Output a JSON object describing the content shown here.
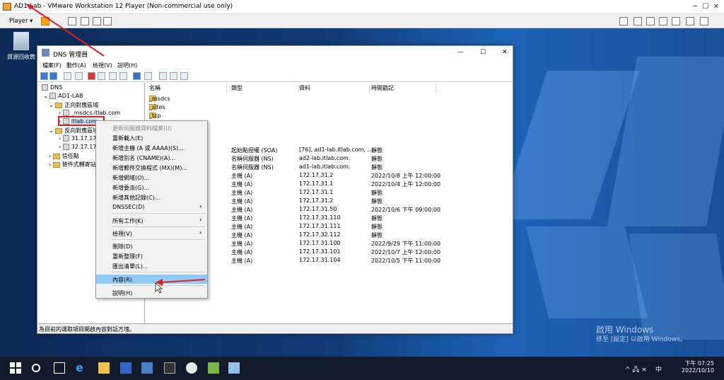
{
  "vmware": {
    "title": "AD1-Lab - VMware Workstation 12 Player (Non-commercial use only)",
    "player_menu": "Player ▾",
    "minimize": "─",
    "maximize": "☐",
    "close": "✕"
  },
  "desktop": {
    "recycle_bin": "資源回收筒",
    "activate_title": "啟用 Windows",
    "activate_sub": "移至 [設定] 以啟用 Windows。"
  },
  "dns_window": {
    "title": "DNS 管理員",
    "menu": [
      "檔案(F)",
      "動作(A)",
      "檢視(V)",
      "說明(H)"
    ],
    "controls": [
      "—",
      "☐",
      "✕"
    ]
  },
  "tree": {
    "root": "DNS",
    "server": "AD1-LAB",
    "forward": "正向對應區域",
    "msdcs_zone": "_msdcs.itlab.com",
    "itlab_zone": "itlab.com",
    "reverse": "反向對應區域",
    "rev1": "31.17.17",
    "rev2": "32.17.17",
    "trust": "信任點",
    "conditional": "條件式轉寄站"
  },
  "list": {
    "headers": [
      "名稱",
      "類型",
      "資料",
      "時間戳記"
    ],
    "folders": [
      "_msdcs",
      "_sites",
      "_tcp"
    ],
    "rows": [
      {
        "type": "起始點授權 (SOA)",
        "data": "[76], ad1-lab.itlab.com, ...",
        "ts": "靜態"
      },
      {
        "type": "名稱伺服器 (NS)",
        "data": "ad2-lab.itlab.com.",
        "ts": "靜態"
      },
      {
        "type": "名稱伺服器 (NS)",
        "data": "ad1-lab.itlab.com.",
        "ts": "靜態"
      },
      {
        "type": "主機 (A)",
        "data": "172.17.31.2",
        "ts": "2022/10/8 上午 12:00:00"
      },
      {
        "type": "主機 (A)",
        "data": "172.17.31.1",
        "ts": "2022/10/4 上午 12:00:00"
      },
      {
        "type": "主機 (A)",
        "data": "172.17.31.1",
        "ts": "靜態"
      },
      {
        "type": "主機 (A)",
        "data": "172.17.31.2",
        "ts": "靜態"
      },
      {
        "type": "主機 (A)",
        "data": "172.17.31.50",
        "ts": "2022/10/6 下午 09:00:00"
      },
      {
        "type": "主機 (A)",
        "data": "172.17.31.110",
        "ts": "靜態"
      },
      {
        "type": "主機 (A)",
        "data": "172.17.31.111",
        "ts": "靜態"
      },
      {
        "type": "主機 (A)",
        "data": "172.17.32.112",
        "ts": "靜態"
      },
      {
        "type": "主機 (A)",
        "data": "172.17.31.100",
        "ts": "2022/9/29 下午 11:00:00"
      },
      {
        "type": "主機 (A)",
        "data": "172.17.31.101",
        "ts": "2022/10/7 上午 12:00:00"
      },
      {
        "type": "主機 (A)",
        "data": "172.17.31.104",
        "ts": "2022/10/5 下午 11:00:00"
      }
    ]
  },
  "context_menu": {
    "update": "更新伺服器資料檔案(U)",
    "reload": "重新載入(E)",
    "new_host": "新增主機 (A 或 AAAA)(S)...",
    "new_alias": "新增別名 (CNAME)(A)...",
    "new_mx": "新增郵件交換程式 (MX)(M)...",
    "new_domain": "新增網域(O)...",
    "new_delegation": "新增委派(G)...",
    "other_records": "新增其他記錄(C)...",
    "dnssec": "DNSSEC(D)",
    "all_tasks": "所有工作(K)",
    "view": "檢視(V)",
    "delete": "刪除(D)",
    "refresh": "重新整理(F)",
    "export": "匯出清單(L)...",
    "properties": "內容(R)",
    "help": "說明(H)",
    "submenu_arrow": "›"
  },
  "status_bar": "為目前的選取項目開啟內容對話方塊。",
  "taskbar": {
    "time": "下午 07:25",
    "date": "2022/10/10",
    "ime": "中",
    "tray": "^ 🖧 ×"
  },
  "colors": {
    "annotation": "#e02020",
    "highlight": "#91c9f7"
  }
}
